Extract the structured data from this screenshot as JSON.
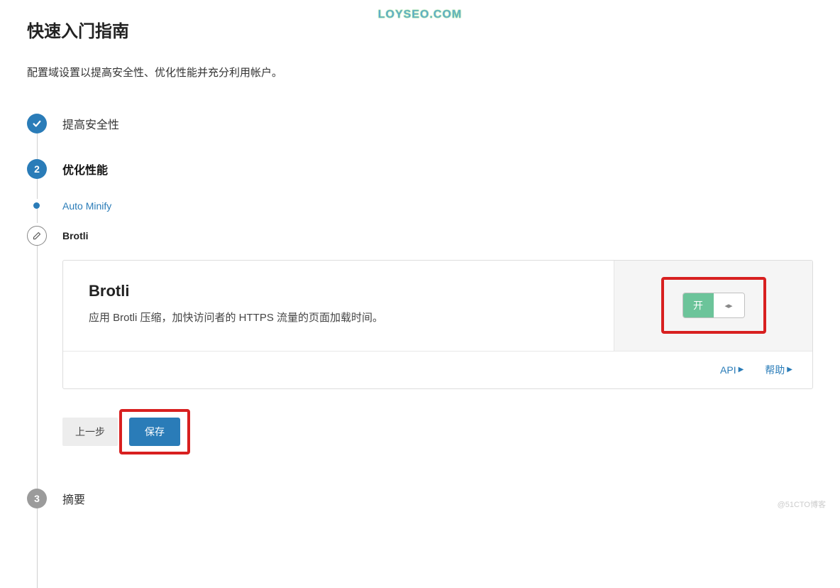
{
  "watermark_top": "LOYSEO.COM",
  "watermark_bottom": "@51CTO博客",
  "page_title": "快速入门指南",
  "page_subtitle": "配置域设置以提高安全性、优化性能并充分利用帐户。",
  "steps": {
    "security": {
      "label": "提高安全性"
    },
    "performance": {
      "number": "2",
      "label": "优化性能"
    },
    "auto_minify": {
      "label": "Auto Minify"
    },
    "brotli": {
      "label": "Brotli"
    },
    "summary": {
      "number": "3",
      "label": "摘要"
    }
  },
  "card": {
    "title": "Brotli",
    "description": "应用 Brotli 压缩，加快访问者的 HTTPS 流量的页面加载时间。",
    "toggle_on": "开",
    "api_link": "API",
    "help_link": "帮助"
  },
  "buttons": {
    "prev": "上一步",
    "save": "保存"
  }
}
